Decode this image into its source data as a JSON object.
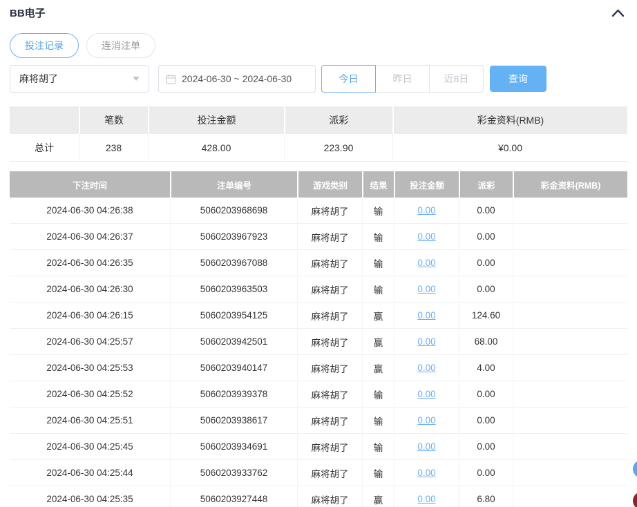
{
  "header": {
    "title": "BB电子"
  },
  "tabs": [
    {
      "label": "投注记录"
    },
    {
      "label": "连消注单"
    }
  ],
  "filters": {
    "game_select_value": "麻将胡了",
    "date_range_value": "2024-06-30 ~ 2024-06-30",
    "quick_ranges": [
      "今日",
      "昨日",
      "近8日"
    ],
    "query_label": "查询"
  },
  "summary_table": {
    "headers": [
      "",
      "笔数",
      "投注金额",
      "派彩",
      "彩金资料(RMB)"
    ],
    "total": {
      "label": "总计",
      "count": "238",
      "bet_amount": "428.00",
      "payout": "223.90",
      "bonus": "¥0.00"
    }
  },
  "detail_table": {
    "headers": [
      "下注时间",
      "注单编号",
      "游戏类别",
      "结果",
      "投注金额",
      "派彩",
      "彩金资料(RMB)"
    ],
    "rows": [
      [
        "2024-06-30 04:26:38",
        "5060203968698",
        "麻将胡了",
        "输",
        "0.00",
        "0.00",
        ""
      ],
      [
        "2024-06-30 04:26:37",
        "5060203967923",
        "麻将胡了",
        "输",
        "0.00",
        "0.00",
        ""
      ],
      [
        "2024-06-30 04:26:35",
        "5060203967088",
        "麻将胡了",
        "输",
        "0.00",
        "0.00",
        ""
      ],
      [
        "2024-06-30 04:26:30",
        "5060203963503",
        "麻将胡了",
        "输",
        "0.00",
        "0.00",
        ""
      ],
      [
        "2024-06-30 04:26:15",
        "5060203954125",
        "麻将胡了",
        "赢",
        "0.00",
        "124.60",
        ""
      ],
      [
        "2024-06-30 04:25:57",
        "5060203942501",
        "麻将胡了",
        "赢",
        "0.00",
        "68.00",
        ""
      ],
      [
        "2024-06-30 04:25:53",
        "5060203940147",
        "麻将胡了",
        "赢",
        "0.00",
        "4.00",
        ""
      ],
      [
        "2024-06-30 04:25:52",
        "5060203939378",
        "麻将胡了",
        "输",
        "0.00",
        "0.00",
        ""
      ],
      [
        "2024-06-30 04:25:51",
        "5060203938617",
        "麻将胡了",
        "输",
        "0.00",
        "0.00",
        ""
      ],
      [
        "2024-06-30 04:25:45",
        "5060203934691",
        "麻将胡了",
        "输",
        "0.00",
        "0.00",
        ""
      ],
      [
        "2024-06-30 04:25:44",
        "5060203933762",
        "麻将胡了",
        "输",
        "0.00",
        "0.00",
        ""
      ],
      [
        "2024-06-30 04:25:35",
        "5060203927448",
        "麻将胡了",
        "赢",
        "0.00",
        "6.80",
        ""
      ]
    ]
  },
  "colors": {
    "accent_blue": "#4f9ff0",
    "link_blue": "#6aaef3",
    "query_button_blue": "#64b2f3",
    "detail_header_bg": "#b9b9b9",
    "summary_header_bg": "#ececec",
    "floating_blue": "#55aaf3",
    "floating_red": "#8d2428"
  }
}
